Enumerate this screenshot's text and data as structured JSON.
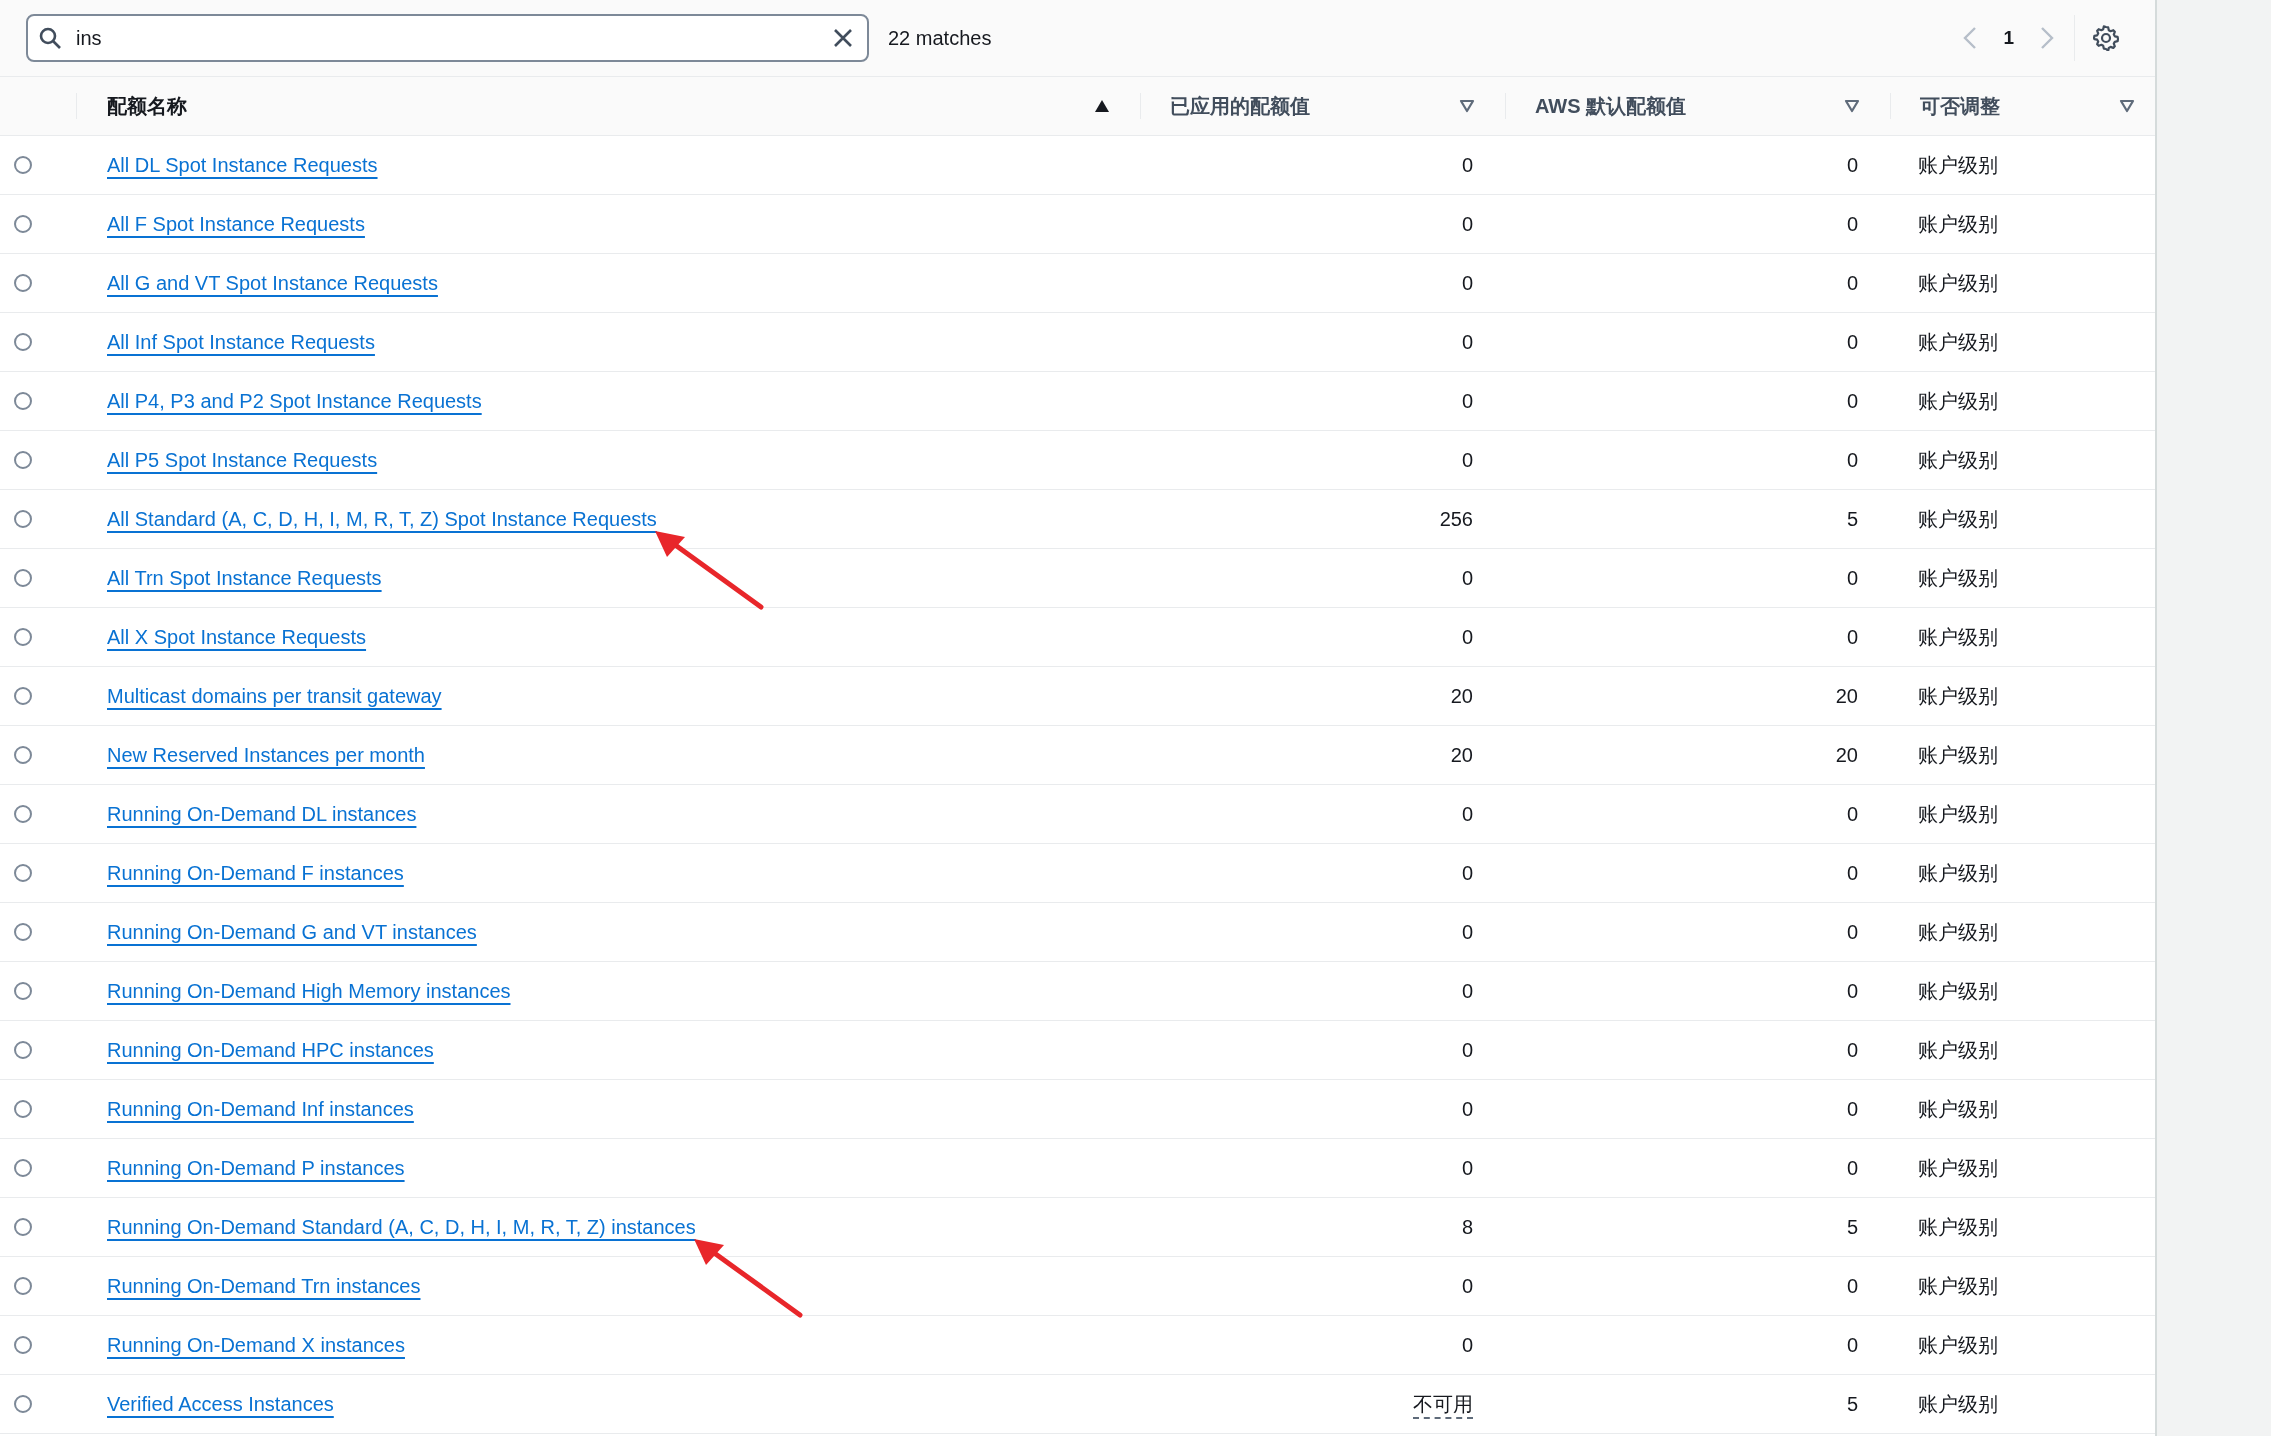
{
  "search": {
    "value": "ins",
    "result_count": "22 matches"
  },
  "pagination": {
    "prev_disabled": true,
    "next_disabled": true,
    "pages": [
      {
        "label": "1",
        "selected": true
      }
    ]
  },
  "table": {
    "columns": [
      {
        "label": "配额名称",
        "sorted": true
      },
      {
        "label": "已应用的配额值",
        "sorted": false
      },
      {
        "label": "AWS 默认配额值",
        "sorted": false
      },
      {
        "label": "可否调整",
        "sorted": false
      }
    ],
    "rows": [
      {
        "selected": false,
        "name": "All DL Spot Instance Requests",
        "applied": "0",
        "applied_underlined": false,
        "default": "0",
        "adjustable": "账户级别",
        "marked": false
      },
      {
        "selected": false,
        "name": "All F Spot Instance Requests",
        "applied": "0",
        "applied_underlined": false,
        "default": "0",
        "adjustable": "账户级别",
        "marked": false
      },
      {
        "selected": false,
        "name": "All G and VT Spot Instance Requests",
        "applied": "0",
        "applied_underlined": false,
        "default": "0",
        "adjustable": "账户级别",
        "marked": false
      },
      {
        "selected": false,
        "name": "All Inf Spot Instance Requests",
        "applied": "0",
        "applied_underlined": false,
        "default": "0",
        "adjustable": "账户级别",
        "marked": false
      },
      {
        "selected": false,
        "name": "All P4, P3 and P2 Spot Instance Requests",
        "applied": "0",
        "applied_underlined": false,
        "default": "0",
        "adjustable": "账户级别",
        "marked": false
      },
      {
        "selected": false,
        "name": "All P5 Spot Instance Requests",
        "applied": "0",
        "applied_underlined": false,
        "default": "0",
        "adjustable": "账户级别",
        "marked": false
      },
      {
        "selected": false,
        "name": "All Standard (A, C, D, H, I, M, R, T, Z) Spot Instance Requests",
        "applied": "256",
        "applied_underlined": false,
        "default": "5",
        "adjustable": "账户级别",
        "marked": true
      },
      {
        "selected": false,
        "name": "All Trn Spot Instance Requests",
        "applied": "0",
        "applied_underlined": false,
        "default": "0",
        "adjustable": "账户级别",
        "marked": false
      },
      {
        "selected": false,
        "name": "All X Spot Instance Requests",
        "applied": "0",
        "applied_underlined": false,
        "default": "0",
        "adjustable": "账户级别",
        "marked": false
      },
      {
        "selected": false,
        "name": "Multicast domains per transit gateway",
        "applied": "20",
        "applied_underlined": false,
        "default": "20",
        "adjustable": "账户级别",
        "marked": false
      },
      {
        "selected": false,
        "name": "New Reserved Instances per month",
        "applied": "20",
        "applied_underlined": false,
        "default": "20",
        "adjustable": "账户级别",
        "marked": false
      },
      {
        "selected": false,
        "name": "Running On-Demand DL instances",
        "applied": "0",
        "applied_underlined": false,
        "default": "0",
        "adjustable": "账户级别",
        "marked": false
      },
      {
        "selected": false,
        "name": "Running On-Demand F instances",
        "applied": "0",
        "applied_underlined": false,
        "default": "0",
        "adjustable": "账户级别",
        "marked": false
      },
      {
        "selected": false,
        "name": "Running On-Demand G and VT instances",
        "applied": "0",
        "applied_underlined": false,
        "default": "0",
        "adjustable": "账户级别",
        "marked": false
      },
      {
        "selected": false,
        "name": "Running On-Demand High Memory instances",
        "applied": "0",
        "applied_underlined": false,
        "default": "0",
        "adjustable": "账户级别",
        "marked": false
      },
      {
        "selected": false,
        "name": "Running On-Demand HPC instances",
        "applied": "0",
        "applied_underlined": false,
        "default": "0",
        "adjustable": "账户级别",
        "marked": false
      },
      {
        "selected": false,
        "name": "Running On-Demand Inf instances",
        "applied": "0",
        "applied_underlined": false,
        "default": "0",
        "adjustable": "账户级别",
        "marked": false
      },
      {
        "selected": false,
        "name": "Running On-Demand P instances",
        "applied": "0",
        "applied_underlined": false,
        "default": "0",
        "adjustable": "账户级别",
        "marked": false
      },
      {
        "selected": false,
        "name": "Running On-Demand Standard (A, C, D, H, I, M, R, T, Z) instances",
        "applied": "8",
        "applied_underlined": false,
        "default": "5",
        "adjustable": "账户级别",
        "marked": true
      },
      {
        "selected": false,
        "name": "Running On-Demand Trn instances",
        "applied": "0",
        "applied_underlined": false,
        "default": "0",
        "adjustable": "账户级别",
        "marked": false
      },
      {
        "selected": false,
        "name": "Running On-Demand X instances",
        "applied": "0",
        "applied_underlined": false,
        "default": "0",
        "adjustable": "账户级别",
        "marked": false
      },
      {
        "selected": false,
        "name": "Verified Access Instances",
        "applied": "不可用",
        "applied_underlined": true,
        "default": "5",
        "adjustable": "账户级别",
        "marked": false
      }
    ]
  }
}
